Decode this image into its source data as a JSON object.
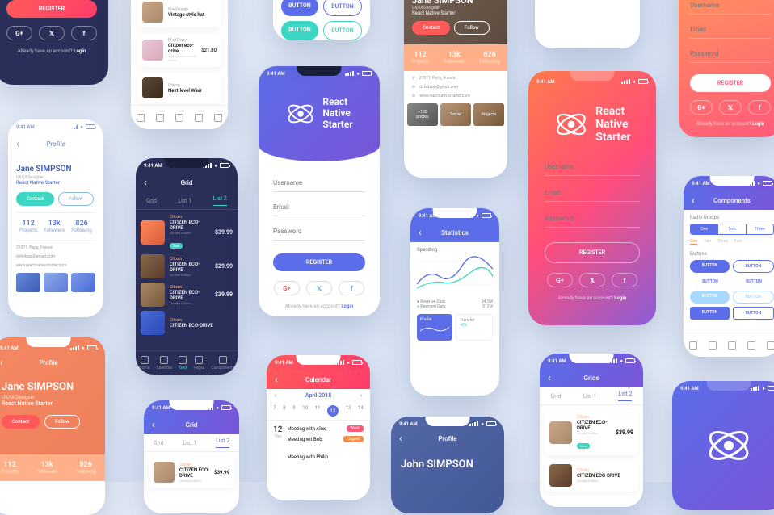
{
  "time": "9:41 AM",
  "brand": "React\nNative\nStarter",
  "auth": {
    "username": "Username",
    "email": "Email",
    "password": "Password",
    "register": "REGISTER",
    "login_prompt": "Already have an account?",
    "login": "Login"
  },
  "social": {
    "g": "G+",
    "t": "𝕏",
    "f": "f"
  },
  "profile": {
    "title": "Profile",
    "name": "Jane SIMPSON",
    "role": "UX/UI Designer",
    "company": "React Native Starter",
    "contact": "Contact",
    "follow": "Follow",
    "stats": [
      {
        "n": "112",
        "l": "Projects"
      },
      {
        "n": "13k",
        "l": "Followers"
      },
      {
        "n": "826",
        "l": "Following"
      }
    ],
    "loc": "21571, Paris, France",
    "em": "dxfelixop@gmail.com",
    "web": "www.reactnativestarter.com",
    "gallery": [
      "+150\nphotos",
      "Social",
      "Projects"
    ]
  },
  "profile2_name": "John SIMPSON",
  "grid": {
    "title": "Grid",
    "title2": "Grids",
    "tabs": [
      "Grid",
      "List 1",
      "List 2"
    ],
    "cat": "Citizen",
    "prod": "CITIZEN ECO-DRIVE",
    "sub": "Limited Edition",
    "p1": "$39.99",
    "p2": "$29.99",
    "p3": "$21.80",
    "new": "New"
  },
  "list": {
    "cat1": "WaeDesign",
    "n1": "Vintage style hat",
    "cat2": "Mad Perry",
    "n2": "Citizen eco-drive",
    "s2": "20% off larif esmod Direst",
    "cat3": "Ciborn",
    "n3": "Next-level Wear"
  },
  "buttons": {
    "label": "BUTTON"
  },
  "calendar": {
    "title": "Calendar",
    "month": "April 2018",
    "days": [
      "7",
      "8",
      "9",
      "10",
      "11",
      "12",
      "13",
      "14"
    ],
    "selected": "12",
    "events": [
      {
        "t": "Meeting with Alex",
        "tag": "Work",
        "c": "#ff5a7a"
      },
      {
        "t": "Meeting wit Bob",
        "tag": "Urgent",
        "c": "#ff8a3d"
      },
      {
        "t": "Meeting with Philip",
        "tag": "",
        "c": ""
      }
    ],
    "daylabel": "Thu"
  },
  "statscreen": {
    "title": "Statistics",
    "spend": "Spending",
    "l1": "Revenue Data",
    "l2": "Payment Data",
    "v1": "$4.5M",
    "v2": "$12M",
    "tabs": [
      "Profile",
      "Transfer"
    ],
    "pct": "+8%"
  },
  "comp": {
    "title": "Components",
    "rg": "Radio Groups",
    "rgopts": [
      "One",
      "Two",
      "Three"
    ],
    "rgopts2": [
      "One",
      "Two",
      "Three",
      "Four"
    ],
    "btns": "Buttons"
  },
  "nav": [
    "Home",
    "Calendar",
    "Grid",
    "Pages",
    "Components"
  ]
}
